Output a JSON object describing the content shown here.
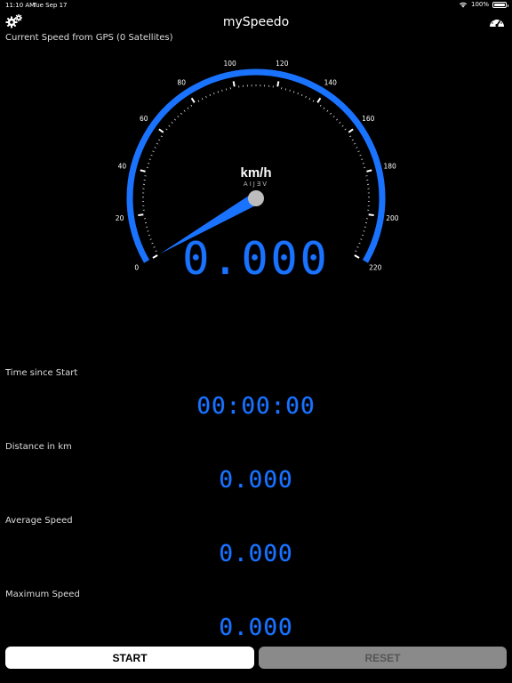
{
  "status_bar": {
    "time": "11:10 AM",
    "date": "Tue Sep 17",
    "battery": "100%"
  },
  "nav": {
    "title": "mySpeedo",
    "left_icon": "gears-icon",
    "right_icon": "speedometer-icon"
  },
  "gps_label": "Current Speed from GPS (0 Satellites)",
  "gauge": {
    "unit": "km/h",
    "brand_mirrored": "AIJƎV",
    "scale_labels": [
      "0",
      "20",
      "40",
      "60",
      "80",
      "100",
      "120",
      "140",
      "160",
      "180",
      "200",
      "220"
    ],
    "needle_value": 0,
    "accent_color": "#1a73ff"
  },
  "current_speed": "0.000",
  "stats": {
    "time_label": "Time since Start",
    "time_value": "00:00:00",
    "distance_label": "Distance in km",
    "distance_value": "0.000",
    "avg_label": "Average Speed",
    "avg_value": "0.000",
    "max_label": "Maximum Speed",
    "max_value": "0.000"
  },
  "buttons": {
    "start": "START",
    "reset": "RESET"
  }
}
